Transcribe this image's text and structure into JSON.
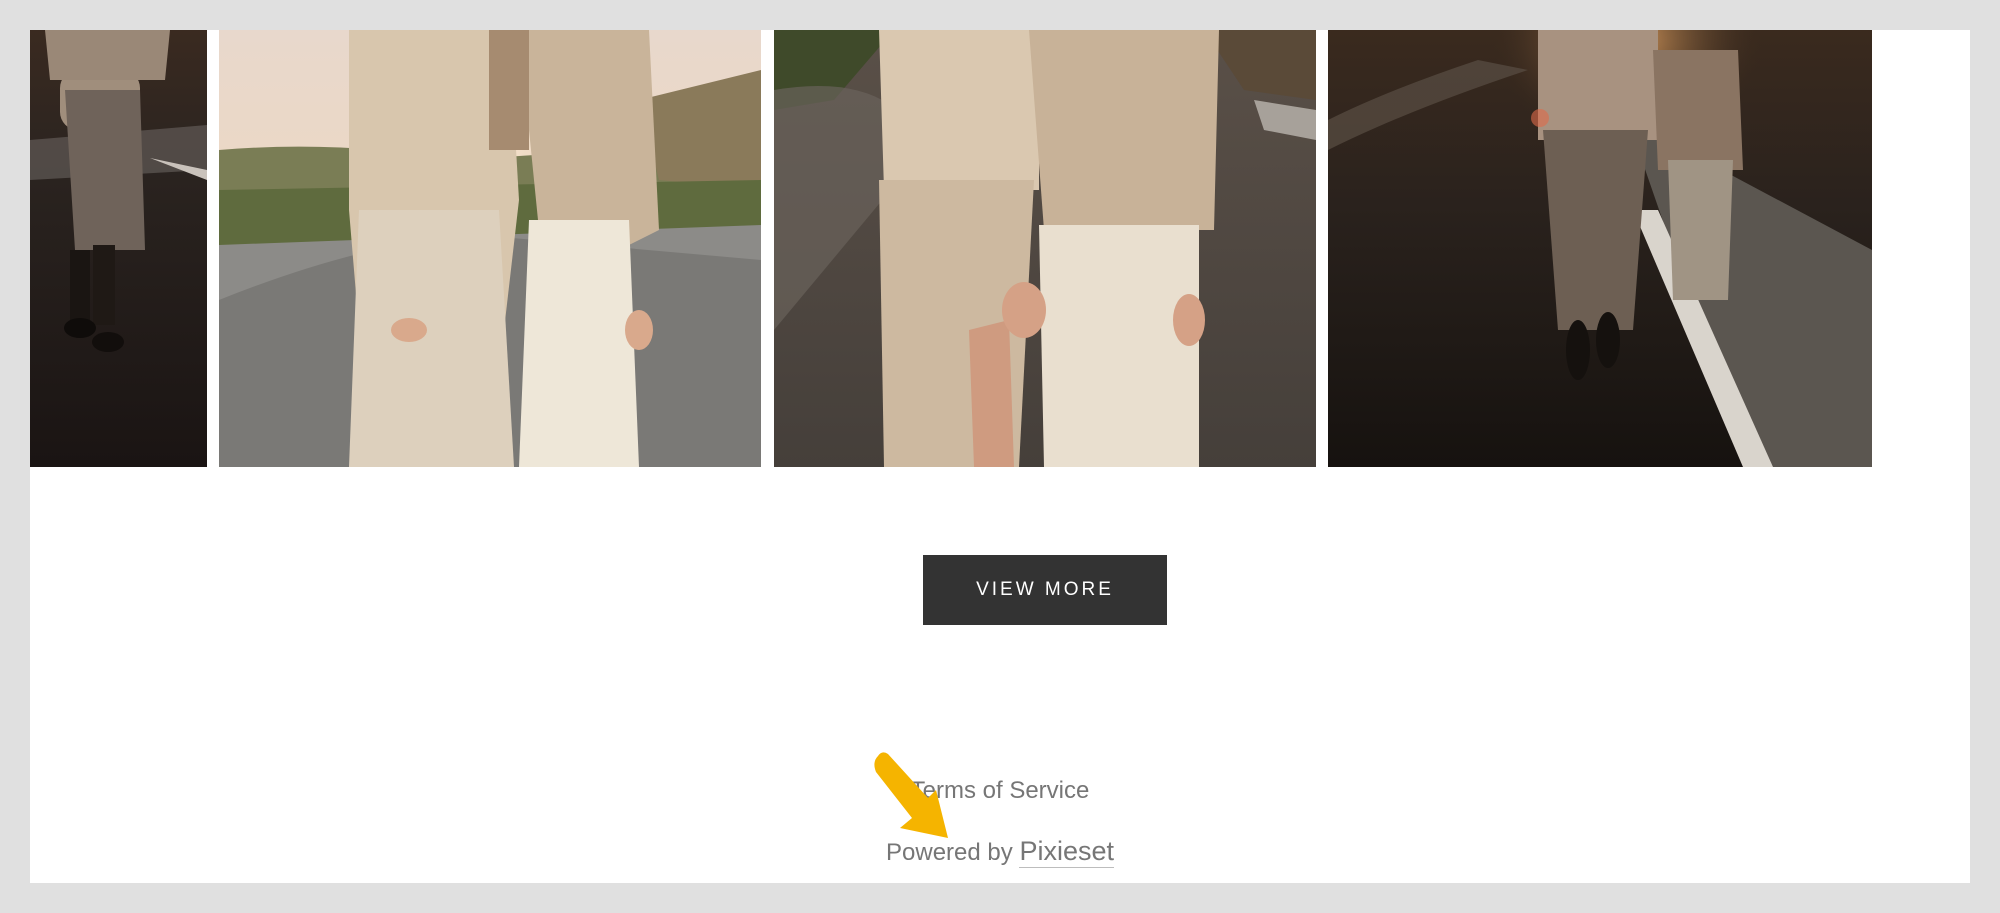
{
  "gallery": {
    "photos": [
      {
        "name": "gallery-photo-1"
      },
      {
        "name": "gallery-photo-2"
      },
      {
        "name": "gallery-photo-3"
      },
      {
        "name": "gallery-photo-4"
      }
    ]
  },
  "actions": {
    "view_more_label": "VIEW MORE"
  },
  "footer": {
    "terms_label": "Terms of Service",
    "powered_prefix": "Powered by",
    "powered_brand": "Pixieset"
  },
  "annotation": {
    "pointer_icon": "arrow-pointer-icon",
    "pointer_color": "#f5b400"
  },
  "colors": {
    "page_bg": "#e0e0e0",
    "content_bg": "#ffffff",
    "button_bg": "#333333",
    "footer_text": "#767676"
  }
}
